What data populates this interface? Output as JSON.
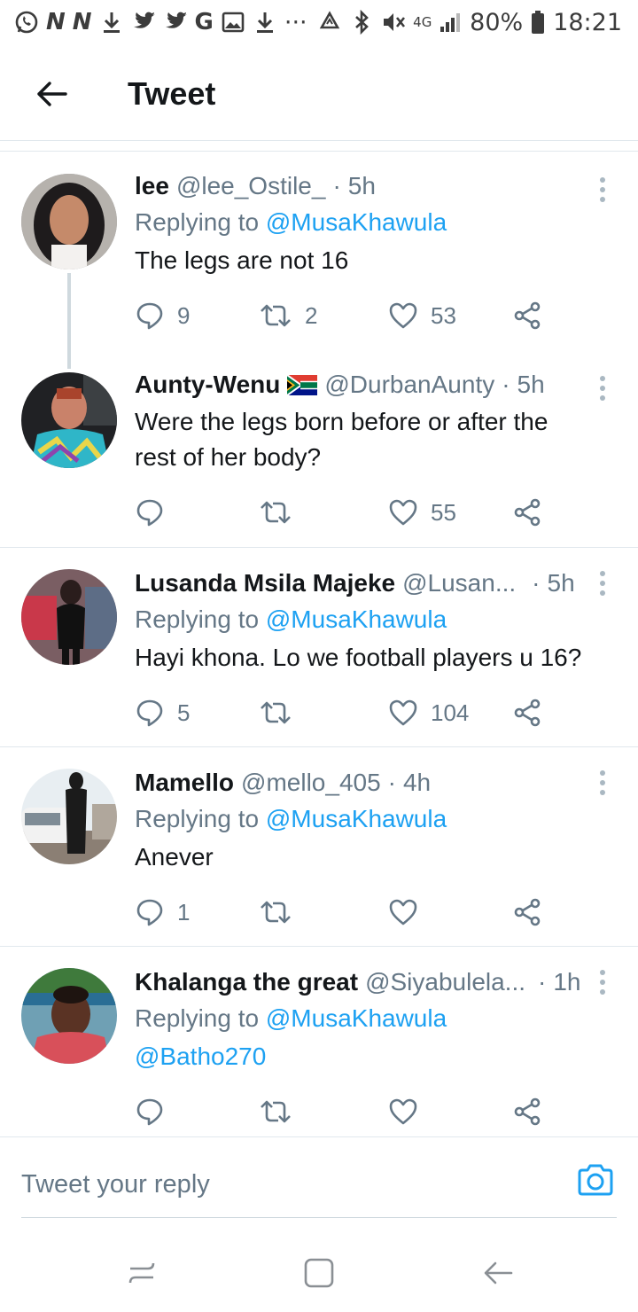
{
  "status_bar": {
    "nn_1": "N",
    "nn_2": "N",
    "g_letter": "G",
    "ellipsis": "···",
    "network": "4G",
    "battery": "80%",
    "time": "18:21",
    "icons": [
      "whatsapp-icon",
      "download-icon",
      "twitter-icon",
      "twitter-icon",
      "gallery-icon",
      "download-icon",
      "recycle-icon",
      "bluetooth-icon",
      "mute-icon",
      "signal-icon",
      "battery-icon"
    ]
  },
  "header": {
    "title": "Tweet",
    "back_icon": "arrow-left-icon"
  },
  "colors": {
    "link": "#1da1f2",
    "secondary_text": "#657786",
    "primary_text": "#14171a",
    "divider": "#e1e8ed"
  },
  "tweets": [
    {
      "name": "lee",
      "handle": "@lee_Ostile_",
      "dot": "·",
      "time": "5h",
      "replying_prefix": "Replying to",
      "replying_to": "@MusaKhawula",
      "text": "The legs are not 16",
      "replies": "9",
      "retweets": "2",
      "likes": "53"
    },
    {
      "name": "Aunty-Wenu",
      "flag": "south-africa-flag",
      "handle": "@DurbanAunty",
      "dot": "·",
      "time": "5h",
      "text_line1": "Were the legs born before or after the",
      "text_line2": "rest of her body?",
      "likes": "55"
    },
    {
      "name": "Lusanda Msila Majeke",
      "handle": "@Lusan...",
      "dot": "·",
      "time": "5h",
      "replying_prefix": "Replying to",
      "replying_to": "@MusaKhawula",
      "text": "Hayi khona. Lo we football players u 16?",
      "replies": "5",
      "likes": "104"
    },
    {
      "name": "Mamello",
      "handle": "@mello_405",
      "dot": "·",
      "time": "4h",
      "replying_prefix": "Replying to",
      "replying_to": "@MusaKhawula",
      "text": "Anever",
      "replies": "1"
    },
    {
      "name": "Khalanga the great",
      "handle": "@Siyabulela...",
      "dot": "·",
      "time": "1h",
      "replying_prefix": "Replying to",
      "replying_to": "@MusaKhawula",
      "text_mention": "@Batho270"
    }
  ],
  "reply_bar": {
    "placeholder": "Tweet your reply",
    "camera_icon": "camera-icon"
  },
  "nav_bar": {
    "icons": [
      "recent-apps-icon",
      "home-icon",
      "back-icon"
    ]
  }
}
